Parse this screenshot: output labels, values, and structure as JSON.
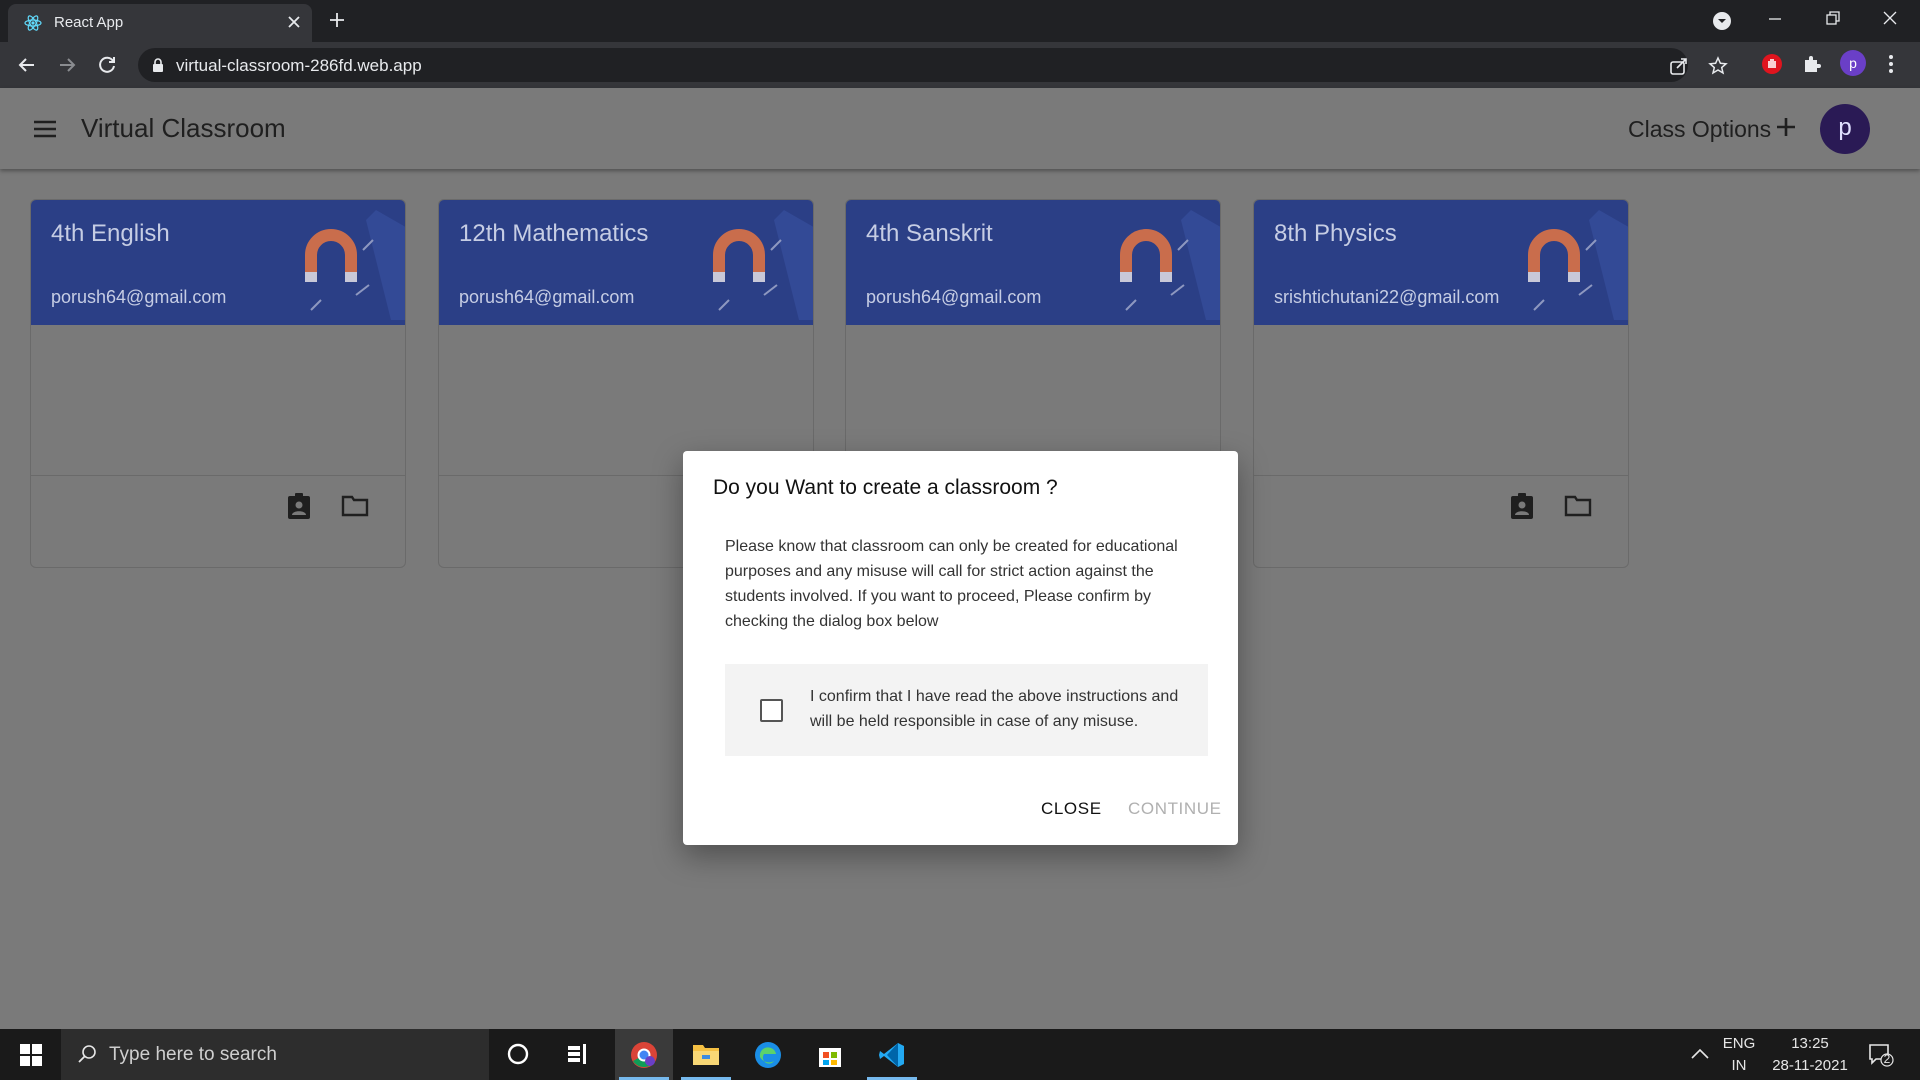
{
  "browser": {
    "tab_title": "React App",
    "url": "virtual-classroom-286fd.web.app",
    "profile_initial": "p"
  },
  "app": {
    "title": "Virtual Classroom",
    "class_options_label": "Class Options",
    "avatar_initial": "p"
  },
  "classes": [
    {
      "name": "4th English",
      "owner": "porush64@gmail.com"
    },
    {
      "name": "12th Mathematics",
      "owner": "porush64@gmail.com"
    },
    {
      "name": "4th Sanskrit",
      "owner": "porush64@gmail.com"
    },
    {
      "name": "8th Physics",
      "owner": "srishtichutani22@gmail.com"
    }
  ],
  "dialog": {
    "title": "Do you Want to create a classroom ?",
    "body": "Please know that classroom can only be created for educational purposes and any misuse will call for strict action against the students involved. If you want to proceed, Please confirm by checking the dialog box below",
    "confirm_text": "I confirm that I have read the above instructions and will be held responsible in case of any misuse.",
    "confirm_checked": false,
    "close_label": "CLOSE",
    "continue_label": "CONTINUE"
  },
  "taskbar": {
    "search_placeholder": "Type here to search",
    "lang_line1": "ENG",
    "lang_line2": "IN",
    "time": "13:25",
    "date": "28-11-2021",
    "notification_count": "2"
  },
  "colors": {
    "card_header": "#2b3f86",
    "avatar": "#2a1a55",
    "backdrop": "#7a7a7a",
    "taskbar_active": "#76b9ed"
  }
}
